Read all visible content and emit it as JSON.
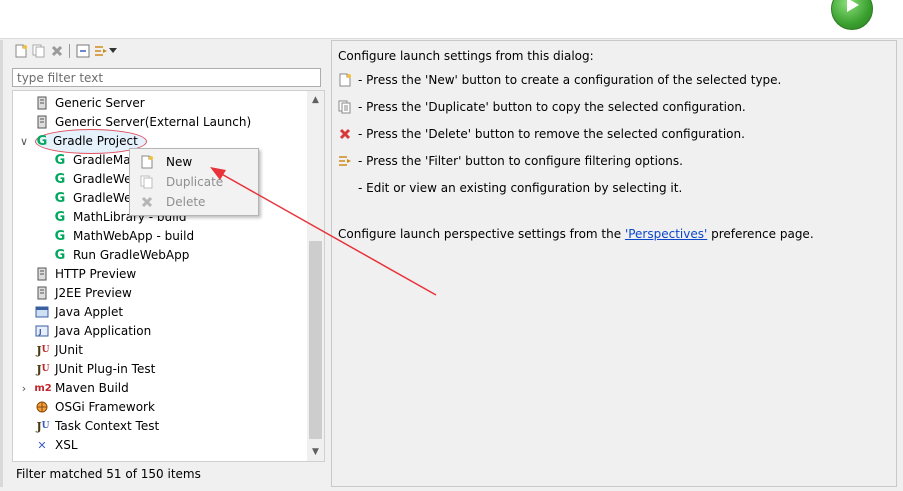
{
  "colors": {
    "gradle_green": "#02a85e",
    "maven_red": "#c0262e",
    "link_blue": "#0a47c9",
    "delete_red": "#d63a3a",
    "annotation_red": "#e8333a"
  },
  "toolbar": {
    "buttons": [
      {
        "icon": "new-config-icon"
      },
      {
        "icon": "duplicate-icon"
      },
      {
        "icon": "delete-icon"
      },
      {
        "icon": "collapse-all-icon"
      },
      {
        "icon": "filter-icon"
      },
      {
        "icon": "dropdown-arrow-icon"
      }
    ]
  },
  "filter": {
    "placeholder": "type filter text",
    "value": ""
  },
  "tree": {
    "items": [
      {
        "label": "Generic Server",
        "icon": "server-icon"
      },
      {
        "label": "Generic Server(External Launch)",
        "icon": "server-icon"
      },
      {
        "label": "Gradle Project",
        "icon": "gradle-icon",
        "expanded": true
      },
      {
        "label": "GradleMa",
        "icon": "gradle-icon"
      },
      {
        "label": "GradleWe",
        "icon": "gradle-icon"
      },
      {
        "label": "GradleWe",
        "icon": "gradle-icon"
      },
      {
        "label": "MathLibrary - build",
        "icon": "gradle-icon"
      },
      {
        "label": "MathWebApp - build",
        "icon": "gradle-icon"
      },
      {
        "label": "Run GradleWebApp",
        "icon": "gradle-icon"
      },
      {
        "label": "HTTP Preview",
        "icon": "server-icon"
      },
      {
        "label": "J2EE Preview",
        "icon": "server-icon"
      },
      {
        "label": "Java Applet",
        "icon": "applet-icon"
      },
      {
        "label": "Java Application",
        "icon": "java-app-icon"
      },
      {
        "label": "JUnit",
        "icon": "junit-icon"
      },
      {
        "label": "JUnit Plug-in Test",
        "icon": "junit-plugin-icon"
      },
      {
        "label": "Maven Build",
        "icon": "maven-icon",
        "collapsed": true
      },
      {
        "label": "OSGi Framework",
        "icon": "osgi-icon"
      },
      {
        "label": "Task Context Test",
        "icon": "task-context-icon"
      },
      {
        "label": "XSL",
        "icon": "xsl-icon"
      }
    ]
  },
  "status": "Filter matched 51 of 150 items",
  "context_menu": {
    "items": [
      {
        "label": "New",
        "enabled": true,
        "icon": "new-config-icon"
      },
      {
        "label": "Duplicate",
        "enabled": false,
        "icon": "duplicate-icon"
      },
      {
        "label": "Delete",
        "enabled": false,
        "icon": "delete-icon"
      }
    ]
  },
  "right": {
    "intro": "Configure launch settings from this dialog:",
    "bullets": [
      {
        "icon": "new-config-icon",
        "text": "- Press the 'New' button to create a configuration of the selected type."
      },
      {
        "icon": "duplicate-icon",
        "text": "- Press the 'Duplicate' button to copy the selected configuration."
      },
      {
        "icon": "delete-icon",
        "text": "- Press the 'Delete' button to remove the selected configuration."
      },
      {
        "icon": "filter-icon",
        "text": "- Press the 'Filter' button to configure filtering options."
      },
      {
        "icon": "",
        "text": "- Edit or view an existing configuration by selecting it."
      }
    ],
    "perspective_prefix": "Configure launch perspective settings from the ",
    "perspective_link": "'Perspectives'",
    "perspective_suffix": " preference page."
  }
}
